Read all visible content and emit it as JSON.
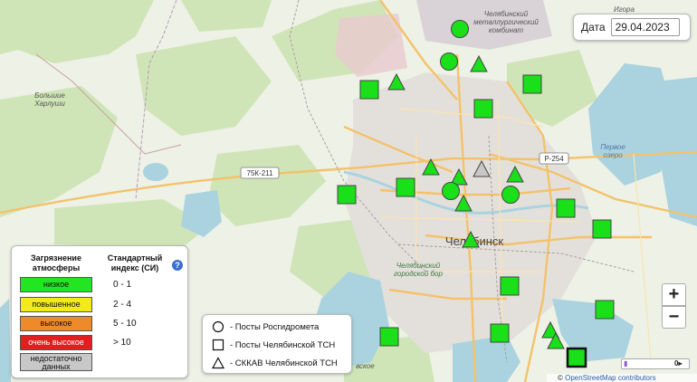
{
  "date_panel": {
    "label": "Дата",
    "value": "29.04.2023"
  },
  "legend": {
    "col1_header": "Загрязнение атмосферы",
    "col2_header": "Стандартный индекс (СИ)",
    "help_icon": "?",
    "levels": [
      {
        "label": "низкое",
        "color": "#22e622",
        "text_color": "#111",
        "range": "0  -  1"
      },
      {
        "label": "повышенное",
        "color": "#f2ea1b",
        "text_color": "#111",
        "range": "2  -  4"
      },
      {
        "label": "высокое",
        "color": "#ef8a2b",
        "text_color": "#111",
        "range": "5  -  10"
      },
      {
        "label": "очень высокое",
        "color": "#e21f1f",
        "text_color": "#fff",
        "range": "> 10"
      },
      {
        "label": "недостаточно данных",
        "color": "#c8c8c8",
        "text_color": "#111",
        "range": ""
      }
    ]
  },
  "symbol_legend": {
    "items": [
      {
        "shape": "circle",
        "label": "- Посты Росгидромета"
      },
      {
        "shape": "square",
        "label": "- Посты Челябинской ТСН"
      },
      {
        "shape": "triangle",
        "label": "- СККАВ Челябинской ТСН"
      }
    ]
  },
  "zoom": {
    "in": "+",
    "out": "−"
  },
  "attribution": {
    "prefix": "© ",
    "link": "OpenStreetMap contributors"
  },
  "map_labels": {
    "city": "Челябинск",
    "metal_plant": "Челябинский металлургический комбинат",
    "bolshie_kharlushi": "Большие Харлуши",
    "igora": "Игора",
    "road_75k": "75К-211",
    "road_r254": "Р-254",
    "lake_pervoe": "Первое озеро",
    "forest": "Челябинский городской бор",
    "bottom_left": "вское"
  },
  "stations": [
    {
      "type": "circle",
      "level": "low"
    },
    {
      "type": "circle",
      "level": "low"
    },
    {
      "type": "triangle",
      "level": "low"
    },
    {
      "type": "triangle",
      "level": "low"
    },
    {
      "type": "square",
      "level": "low"
    },
    {
      "type": "square",
      "level": "low"
    },
    {
      "type": "square",
      "level": "low"
    },
    {
      "type": "triangle",
      "level": "low"
    },
    {
      "type": "triangle",
      "level": "no_data"
    },
    {
      "type": "triangle",
      "level": "low"
    },
    {
      "type": "triangle",
      "level": "low"
    },
    {
      "type": "circle",
      "level": "low"
    },
    {
      "type": "circle",
      "level": "low"
    },
    {
      "type": "square",
      "level": "low"
    },
    {
      "type": "square",
      "level": "low"
    },
    {
      "type": "triangle",
      "level": "low"
    },
    {
      "type": "triangle",
      "level": "low"
    },
    {
      "type": "square",
      "level": "low"
    },
    {
      "type": "square",
      "level": "low"
    },
    {
      "type": "square",
      "level": "low"
    },
    {
      "type": "square",
      "level": "low"
    },
    {
      "type": "square",
      "level": "low"
    },
    {
      "type": "square",
      "level": "low"
    },
    {
      "type": "triangle",
      "level": "low"
    },
    {
      "type": "triangle",
      "level": "low"
    },
    {
      "type": "circle",
      "level": "low"
    },
    {
      "type": "square",
      "level": "low"
    }
  ]
}
